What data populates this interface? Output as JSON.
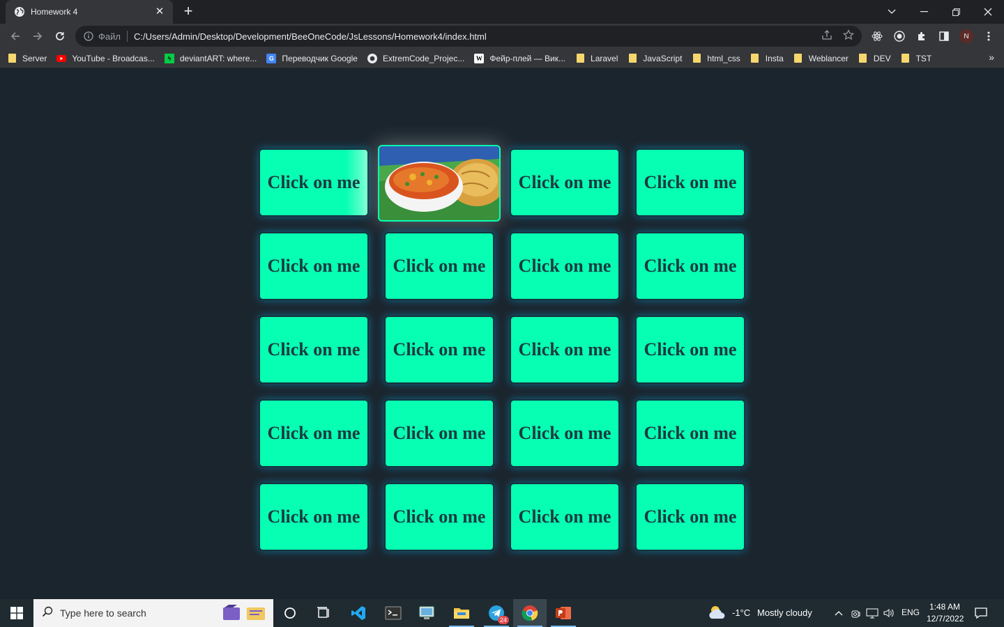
{
  "browser": {
    "tab_title": "Homework 4",
    "new_tab_label": "+",
    "omnibox": {
      "scheme_label": "Файл",
      "url": "C:/Users/Admin/Desktop/Development/BeeOneCode/JsLessons/Homework4/index.html"
    },
    "avatar_initial": "N",
    "bookmarks": [
      {
        "label": "Server",
        "icon": "folder-icon"
      },
      {
        "label": "YouTube - Broadcas...",
        "icon": "youtube-icon"
      },
      {
        "label": "deviantART: where...",
        "icon": "deviantart-icon"
      },
      {
        "label": "Переводчик Google",
        "icon": "google-translate-icon"
      },
      {
        "label": "ExtremCode_Projec...",
        "icon": "github-icon"
      },
      {
        "label": "Фейр-плей — Вик...",
        "icon": "wikipedia-icon"
      },
      {
        "label": "Laravel",
        "icon": "folder-icon"
      },
      {
        "label": "JavaScript",
        "icon": "folder-icon"
      },
      {
        "label": "html_css",
        "icon": "folder-icon"
      },
      {
        "label": "Insta",
        "icon": "folder-icon"
      },
      {
        "label": "Weblancer",
        "icon": "folder-icon"
      },
      {
        "label": "DEV",
        "icon": "folder-icon"
      },
      {
        "label": "TST",
        "icon": "folder-icon"
      }
    ],
    "more_bookmarks": "»"
  },
  "game": {
    "card_label": "Click on me",
    "revealed_card": {
      "index": 1,
      "image": "soup-with-flatbread-image"
    },
    "cards": [
      "Click on me",
      "",
      "Click on me",
      "Click on me",
      "Click on me",
      "Click on me",
      "Click on me",
      "Click on me",
      "Click on me",
      "Click on me",
      "Click on me",
      "Click on me",
      "Click on me",
      "Click on me",
      "Click on me",
      "Click on me",
      "Click on me",
      "Click on me",
      "Click on me",
      "Click on me"
    ],
    "colors": {
      "card": "#06ffb2",
      "text": "#1b3a40",
      "background": "#1b252e",
      "glow": "#00c3ff"
    }
  },
  "taskbar": {
    "search_placeholder": "Type here to search",
    "weather_temp": "-1°C",
    "weather_text": "Mostly cloudy",
    "language": "ENG",
    "time": "1:48 AM",
    "date": "12/7/2022",
    "telegram_badge": "24"
  }
}
